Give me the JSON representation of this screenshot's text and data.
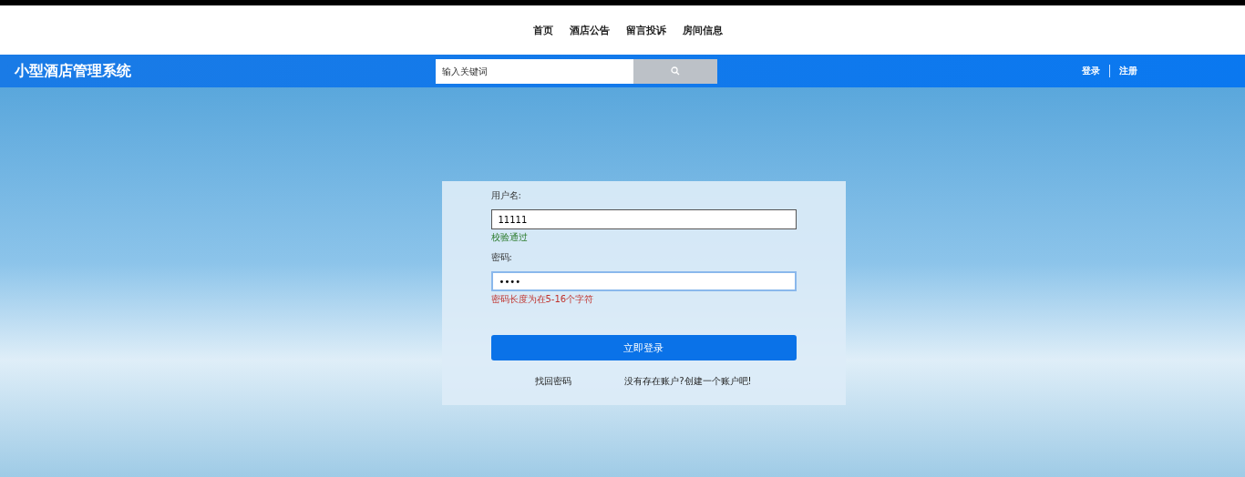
{
  "nav": {
    "items": [
      {
        "label": "首页"
      },
      {
        "label": "酒店公告"
      },
      {
        "label": "留言投诉"
      },
      {
        "label": "房间信息"
      }
    ]
  },
  "header": {
    "title": "小型酒店管理系统",
    "search": {
      "placeholder": "输入关键词"
    },
    "links": [
      {
        "label": "登录"
      },
      {
        "label": "注册"
      }
    ]
  },
  "login_form": {
    "fields": [
      {
        "label": "用户名:",
        "value": "11111",
        "focused": false,
        "message": "校验通过",
        "valid": true
      },
      {
        "label": "密码:",
        "value": "••••",
        "focused": true,
        "message": "密码长度为在5-16个字符",
        "valid": false
      }
    ],
    "submit": "立即登录",
    "links": [
      {
        "label": "找回密码"
      },
      {
        "label": "没有存在账户?创建一个账户吧!"
      }
    ]
  }
}
